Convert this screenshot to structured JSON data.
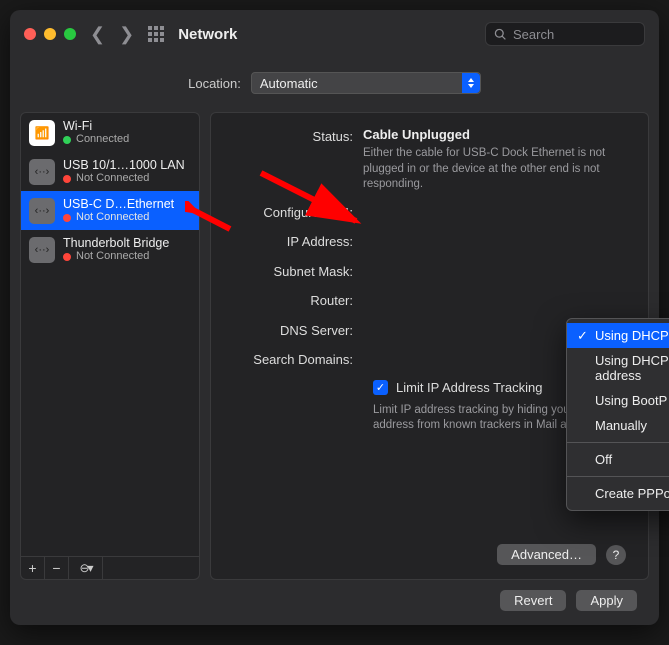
{
  "window": {
    "title": "Network"
  },
  "search": {
    "placeholder": "Search"
  },
  "location": {
    "label": "Location:",
    "value": "Automatic"
  },
  "services": [
    {
      "name": "Wi-Fi",
      "status_text": "Connected",
      "status_color": "green",
      "icon": "wifi",
      "selected": false
    },
    {
      "name": "USB 10/1…1000 LAN",
      "status_text": "Not Connected",
      "status_color": "red",
      "icon": "eth",
      "selected": false
    },
    {
      "name": "USB-C D…Ethernet",
      "status_text": "Not Connected",
      "status_color": "red",
      "icon": "eth",
      "selected": true
    },
    {
      "name": "Thunderbolt Bridge",
      "status_text": "Not Connected",
      "status_color": "red",
      "icon": "eth",
      "selected": false
    }
  ],
  "detail": {
    "status_label": "Status:",
    "status_value": "Cable Unplugged",
    "status_sub": "Either the cable for USB-C Dock Ethernet is not plugged in or the device at the other end is not responding.",
    "labels": {
      "configure": "Configure IPv4:",
      "ip": "IP Address:",
      "subnet": "Subnet Mask:",
      "router": "Router:",
      "dns": "DNS Server:",
      "search_domains": "Search Domains:"
    },
    "limit_tracking_label": "Limit IP Address Tracking",
    "limit_tracking_hint": "Limit IP address tracking by hiding your IP address from known trackers in Mail and Safari.",
    "limit_tracking_checked": true,
    "advanced_button": "Advanced…"
  },
  "configure_menu": {
    "options": [
      "Using DHCP",
      "Using DHCP with manual address",
      "Using BootP",
      "Manually",
      "Off",
      "Create PPPoE Service…"
    ],
    "selected_index": 0,
    "separators_after": [
      3,
      4
    ]
  },
  "footer": {
    "revert": "Revert",
    "apply": "Apply"
  }
}
